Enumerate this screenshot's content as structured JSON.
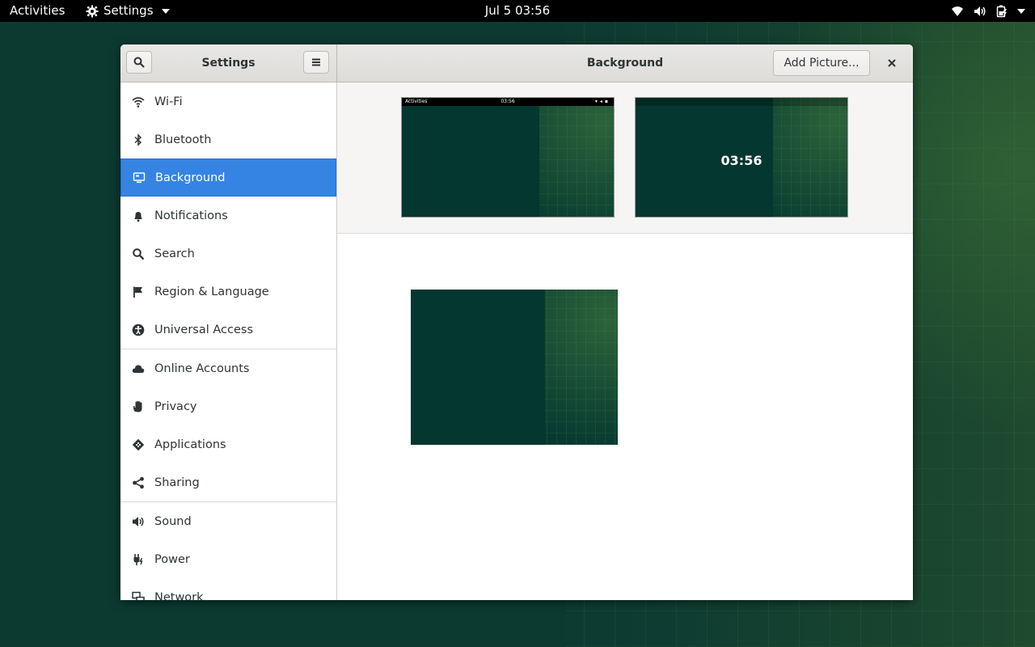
{
  "topbar": {
    "activities": "Activities",
    "app_menu": "Settings",
    "clock": "Jul 5  03:56"
  },
  "window": {
    "sidebar_title": "Settings",
    "panel_title": "Background",
    "add_picture": "Add Picture..."
  },
  "sidebar": {
    "items": [
      {
        "label": "Wi-Fi",
        "icon": "wifi-icon"
      },
      {
        "label": "Bluetooth",
        "icon": "bluetooth-icon"
      },
      {
        "label": "Background",
        "icon": "background-icon",
        "selected": true
      },
      {
        "label": "Notifications",
        "icon": "bell-icon"
      },
      {
        "label": "Search",
        "icon": "search-icon"
      },
      {
        "label": "Region & Language",
        "icon": "flag-icon"
      },
      {
        "label": "Universal Access",
        "icon": "accessibility-icon"
      },
      {
        "label": "Online Accounts",
        "icon": "cloud-icon"
      },
      {
        "label": "Privacy",
        "icon": "hand-icon"
      },
      {
        "label": "Applications",
        "icon": "applications-icon"
      },
      {
        "label": "Sharing",
        "icon": "share-icon"
      },
      {
        "label": "Sound",
        "icon": "speaker-icon"
      },
      {
        "label": "Power",
        "icon": "power-icon"
      },
      {
        "label": "Network",
        "icon": "network-icon"
      }
    ]
  },
  "previews": {
    "desktop_mini": {
      "activities": "Activities",
      "clock": "03:56"
    },
    "lock_time": "03:56"
  },
  "colors": {
    "selection": "#3584e4",
    "wallpaper": "#0c3a31"
  }
}
